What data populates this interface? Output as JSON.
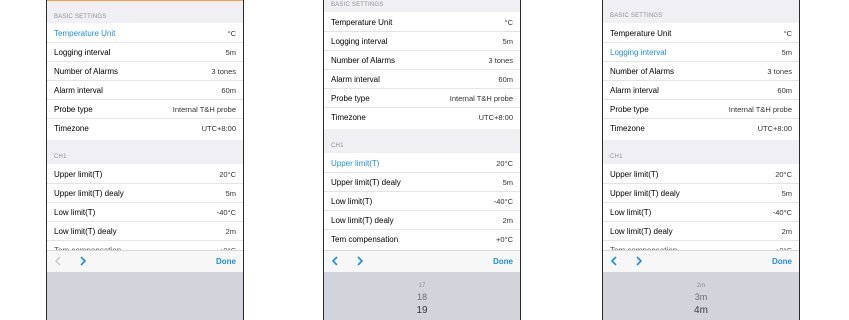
{
  "colors": {
    "accent": "#1b8fe8",
    "section_bg": "#efeff4",
    "picker_bg": "#d1d5db"
  },
  "screens": [
    {
      "section_basic": "BASIC SETTINGS",
      "rows": [
        {
          "label": "Temperature Unit",
          "value": "°C"
        },
        {
          "label": "Logging interval",
          "value": "5m"
        },
        {
          "label": "Number of Alarms",
          "value": "3 tones"
        },
        {
          "label": "Alarm interval",
          "value": "60m"
        },
        {
          "label": "Probe type",
          "value": "Internal T&H probe"
        },
        {
          "label": "Timezone",
          "value": "UTC+8:00"
        }
      ],
      "section_ch": "CH1",
      "ch_rows": [
        {
          "label": "Upper limit(T)",
          "value": "20°C"
        },
        {
          "label": "Upper limit(T) dealy",
          "value": "5m"
        },
        {
          "label": "Low limit(T)",
          "value": "-40°C"
        },
        {
          "label": "Low limit(T) dealy",
          "value": "2m"
        }
      ],
      "partial_label": "Tem compensation",
      "partial_value": "+0°C",
      "done": "Done",
      "picker": []
    },
    {
      "section_basic": "BASIC SETTINGS",
      "rows": [
        {
          "label": "Temperature Unit",
          "value": "°C"
        },
        {
          "label": "Logging interval",
          "value": "5m"
        },
        {
          "label": "Number of Alarms",
          "value": "3 tones"
        },
        {
          "label": "Alarm interval",
          "value": "60m"
        },
        {
          "label": "Probe type",
          "value": "Internal T&H probe"
        },
        {
          "label": "Timezone",
          "value": "UTC+8:00"
        }
      ],
      "section_ch": "CH1",
      "ch_rows": [
        {
          "label": "Upper limit(T)",
          "value": "20°C"
        },
        {
          "label": "Upper limit(T) dealy",
          "value": "5m"
        },
        {
          "label": "Low limit(T)",
          "value": "-40°C"
        },
        {
          "label": "Low limit(T) dealy",
          "value": "2m"
        },
        {
          "label": "Tem compensation",
          "value": "+0°C"
        }
      ],
      "done": "Done",
      "picker": [
        "17",
        "18",
        "19"
      ]
    },
    {
      "section_basic": "BASIC SETTINGS",
      "rows": [
        {
          "label": "Temperature Unit",
          "value": "°C"
        },
        {
          "label": "Logging interval",
          "value": "5m"
        },
        {
          "label": "Number of Alarms",
          "value": "3 tones"
        },
        {
          "label": "Alarm interval",
          "value": "60m"
        },
        {
          "label": "Probe type",
          "value": "Internal T&H probe"
        },
        {
          "label": "Timezone",
          "value": "UTC+8:00"
        }
      ],
      "section_ch": "CH1",
      "ch_rows": [
        {
          "label": "Upper limit(T)",
          "value": "20°C"
        },
        {
          "label": "Upper limit(T) dealy",
          "value": "5m"
        },
        {
          "label": "Low limit(T)",
          "value": "-40°C"
        },
        {
          "label": "Low limit(T) dealy",
          "value": "2m"
        }
      ],
      "partial_label": "Tem compensation",
      "partial_value": "+0°C",
      "done": "Done",
      "picker": [
        "2m",
        "3m",
        "4m"
      ]
    }
  ]
}
